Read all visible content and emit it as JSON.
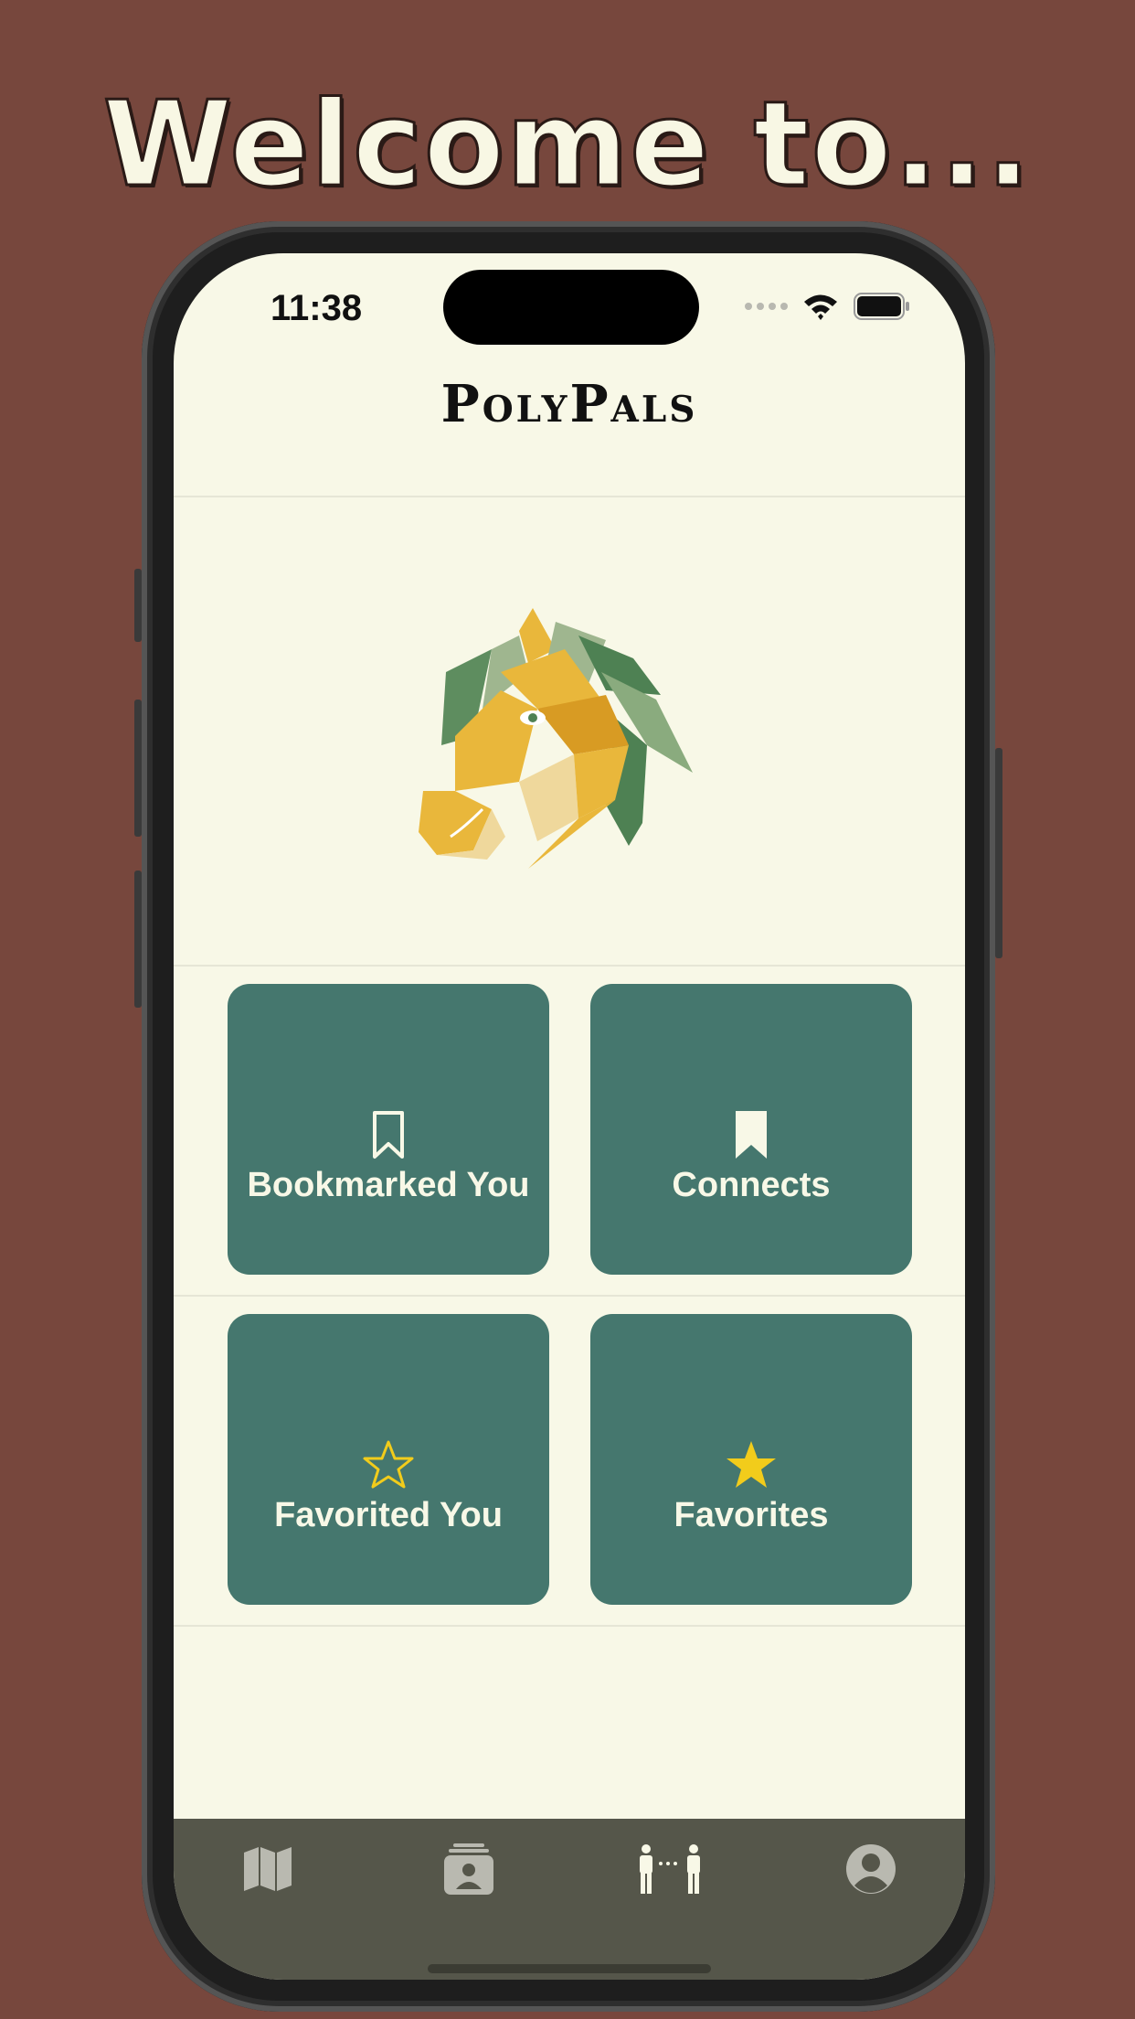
{
  "banner": {
    "headline": "Welcome to..."
  },
  "status_bar": {
    "time": "11:38"
  },
  "app": {
    "title": "PolyPals"
  },
  "tiles": [
    {
      "label": "Bookmarked You",
      "icon": "bookmark-outline-icon"
    },
    {
      "label": "Connects",
      "icon": "bookmark-filled-icon"
    },
    {
      "label": "Favorited You",
      "icon": "star-outline-icon"
    },
    {
      "label": "Favorites",
      "icon": "star-filled-icon"
    }
  ],
  "tab_bar": {
    "items": [
      {
        "icon": "map-icon"
      },
      {
        "icon": "profile-cards-icon"
      },
      {
        "icon": "people-connect-icon"
      },
      {
        "icon": "account-icon"
      }
    ]
  },
  "colors": {
    "background": "#77473d",
    "screen": "#f8f8e7",
    "tile": "#45776e",
    "tab_bar": "#55564a",
    "star": "#f2cc1b"
  }
}
